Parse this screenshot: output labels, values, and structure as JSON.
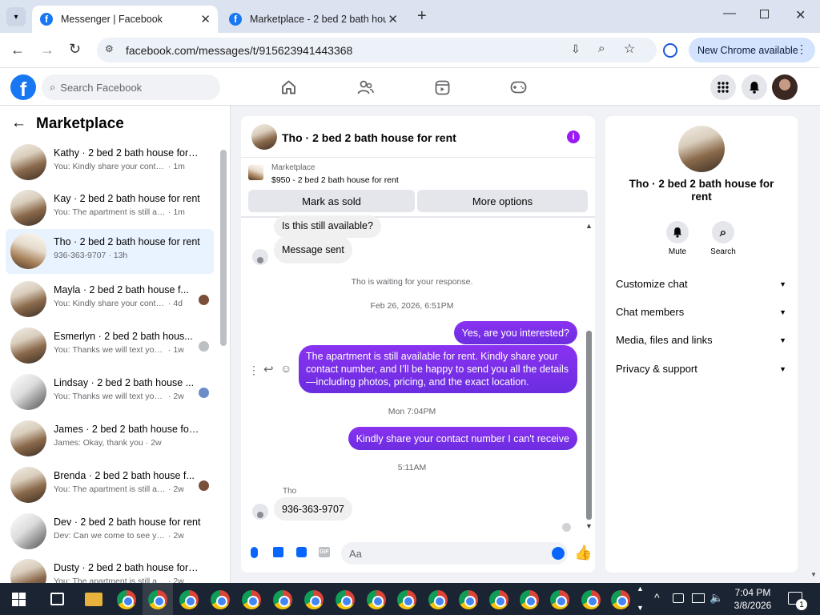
{
  "browser": {
    "tabs": [
      {
        "title": "Messenger | Facebook",
        "active": true
      },
      {
        "title": "Marketplace - 2 bed 2 bath hou",
        "active": false
      }
    ],
    "url": "facebook.com/messages/t/915623941443368",
    "update_label": "New Chrome available"
  },
  "fb": {
    "search_placeholder": "Search Facebook"
  },
  "left": {
    "title": "Marketplace",
    "conversations": [
      {
        "name": "Kathy · 2 bed 2 bath house for r...",
        "preview": "You: Kindly share your contact nu...",
        "time": "· 1m",
        "selected": false
      },
      {
        "name": "Kay · 2 bed 2 bath house for rent",
        "preview": "You: The apartment is still availabl...",
        "time": "· 1m",
        "selected": false
      },
      {
        "name": "Tho · 2 bed 2 bath house for rent",
        "preview": "936-363-9707",
        "time": "· 13h",
        "selected": true
      },
      {
        "name": "Mayla · 2 bed 2 bath house f...",
        "preview": "You: Kindly share your contact ...",
        "time": "· 4d",
        "selected": false
      },
      {
        "name": "Esmerlyn · 2 bed 2 bath hous...",
        "preview": "You: Thanks we will text you so...",
        "time": "· 1w",
        "selected": false
      },
      {
        "name": "Lindsay · 2 bed 2 bath house ...",
        "preview": "You: Thanks we will text you so...",
        "time": "· 2w",
        "selected": false
      },
      {
        "name": "James · 2 bed 2 bath house for ...",
        "preview": "James: Okay, thank you",
        "time": "· 2w",
        "selected": false
      },
      {
        "name": "Brenda · 2 bed 2 bath house f...",
        "preview": "You: The apartment is still availa...",
        "time": "· 2w",
        "selected": false
      },
      {
        "name": "Dev · 2 bed 2 bath house for rent",
        "preview": "Dev: Can we come to see your apa...",
        "time": "· 2w",
        "selected": false
      },
      {
        "name": "Dusty · 2 bed 2 bath house for r...",
        "preview": "You: The apartment is still availabl...",
        "time": "· 2w",
        "selected": false
      }
    ]
  },
  "chat": {
    "header_title": "Tho · 2 bed 2 bath house for rent",
    "listing_source": "Marketplace",
    "listing_text": "$950 - 2 bed 2 bath house for rent",
    "mark_sold": "Mark as sold",
    "more_options": "More options",
    "msg_question": "Is this still available?",
    "msg_sent": "Message sent",
    "waiting": "Tho is waiting for your response.",
    "stamp1": "Feb 26, 2026, 6:51PM",
    "out1": "Yes, are you interested?",
    "out2": "The apartment is still available for rent. Kindly share your contact number, and I’ll be happy to send you all the details—including photos, pricing, and the exact location.",
    "stamp2": "Mon 7:04PM",
    "out3": "Kindly share your contact number I can't receive",
    "stamp3": "5:11AM",
    "sender_name": "Tho",
    "in_phone": "936-363-9707",
    "composer_placeholder": "Aa"
  },
  "right": {
    "title": "Tho · 2 bed 2 bath house for rent",
    "mute": "Mute",
    "search": "Search",
    "sections": [
      "Customize chat",
      "Chat members",
      "Media, files and links",
      "Privacy & support"
    ]
  },
  "taskbar": {
    "time": "7:04 PM",
    "date": "3/8/2026",
    "notif_count": "1"
  },
  "colors": {
    "fb_blue": "#1877f2",
    "messenger_purple": "#7b2ee8"
  }
}
